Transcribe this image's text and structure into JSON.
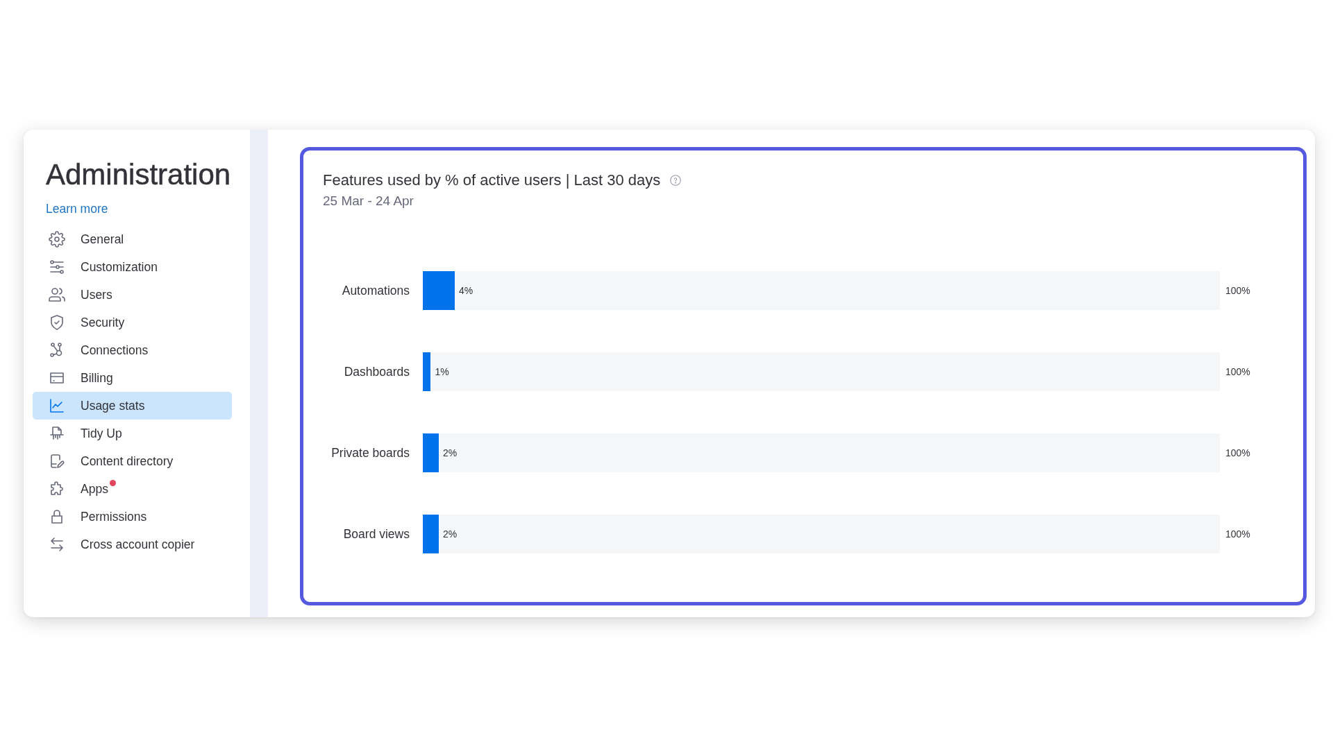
{
  "sidebar": {
    "title": "Administration",
    "link": "Learn more",
    "items": [
      {
        "label": "General",
        "selected": false,
        "notification": false
      },
      {
        "label": "Customization",
        "selected": false,
        "notification": false
      },
      {
        "label": "Users",
        "selected": false,
        "notification": false
      },
      {
        "label": "Security",
        "selected": false,
        "notification": false
      },
      {
        "label": "Connections",
        "selected": false,
        "notification": false
      },
      {
        "label": "Billing",
        "selected": false,
        "notification": false
      },
      {
        "label": "Usage stats",
        "selected": true,
        "notification": false
      },
      {
        "label": "Tidy Up",
        "selected": false,
        "notification": false
      },
      {
        "label": "Content directory",
        "selected": false,
        "notification": false
      },
      {
        "label": "Apps",
        "selected": false,
        "notification": true
      },
      {
        "label": "Permissions",
        "selected": false,
        "notification": false
      },
      {
        "label": "Cross account copier",
        "selected": false,
        "notification": false
      }
    ]
  },
  "usage_panel": {
    "title": "Features used by % of active users | Last 30 days",
    "date_range": "25 Mar - 24 Apr",
    "features": [
      {
        "name": "Automations",
        "level": 0.04,
        "reading": "4%",
        "max_label": "100%"
      },
      {
        "name": "Dashboards",
        "level": 0.01,
        "reading": "1%",
        "max_label": "100%"
      },
      {
        "name": "Private boards",
        "level": 0.02,
        "reading": "2%",
        "max_label": "100%"
      },
      {
        "name": "Board views",
        "level": 0.02,
        "reading": "2%",
        "max_label": "100%"
      }
    ]
  }
}
